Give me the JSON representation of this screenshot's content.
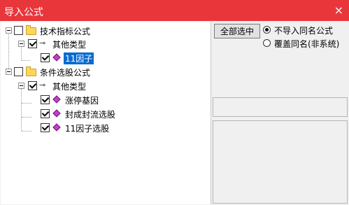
{
  "window": {
    "title": "导入公式",
    "close_glyph": "×"
  },
  "tree": {
    "groups": [
      {
        "label": "技术指标公式",
        "subgroup": "其他类型",
        "items": [
          "11因子"
        ],
        "selected_item": "11因子"
      },
      {
        "label": "条件选股公式",
        "subgroup": "其他类型",
        "items": [
          "涨停基因",
          "封成封流选股",
          "11因子选股"
        ]
      }
    ]
  },
  "options": {
    "select_all_label": "全部选中",
    "radio_no_import": "不导入同名公式",
    "radio_overwrite": "覆盖同名(非系统)",
    "selected": "radio_no_import"
  },
  "colors": {
    "titlebar": "#e8363b",
    "selection": "#0a6bd1",
    "item_icon": "#c33fd0"
  }
}
